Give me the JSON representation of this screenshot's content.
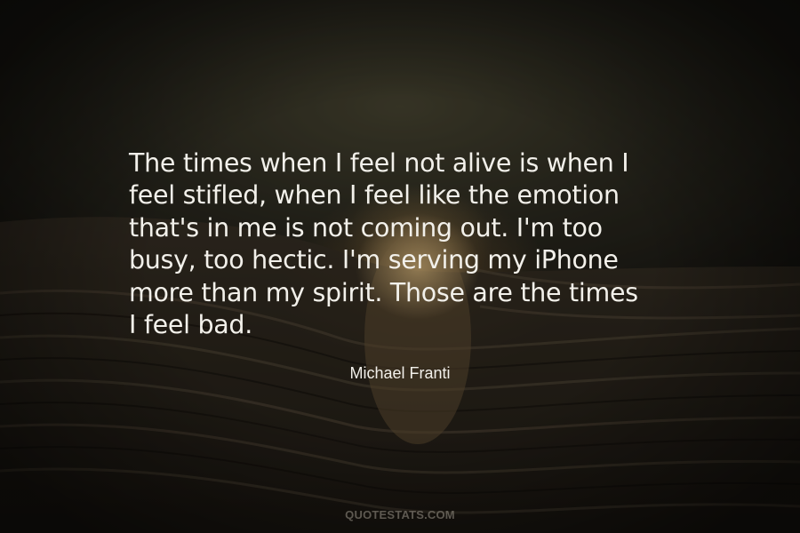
{
  "quote": {
    "lines": [
      "The times when I feel not alive is when I",
      "feel stifled, when I feel like the emotion",
      "that's in me is not coming out. I'm too",
      "busy, too hectic. I'm serving my iPhone",
      "more than my spirit. Those are the times",
      "I feel bad."
    ],
    "author": "Michael Franti"
  },
  "watermark": "QUOTESTATS.COM",
  "colors": {
    "text": "#f2f0ea",
    "background": "#2c2a20",
    "watermark": "#78736a"
  }
}
